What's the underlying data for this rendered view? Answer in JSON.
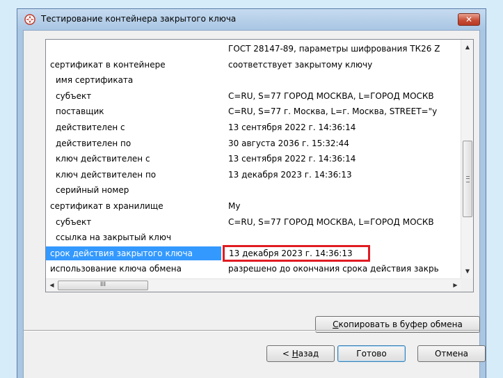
{
  "window": {
    "title": "Тестирование контейнера закрытого ключа",
    "close_label": "✕"
  },
  "grid": {
    "rows": [
      {
        "name": "",
        "value": "ГОСТ 28147-89, параметры шифрования ТК26 Z",
        "indent": false
      },
      {
        "name": "сертификат в контейнере",
        "value": "соответствует закрытому ключу",
        "indent": false
      },
      {
        "name": "имя сертификата",
        "value": "",
        "indent": true
      },
      {
        "name": "субъект",
        "value": "C=RU, S=77 ГОРОД МОСКВА, L=ГОРОД МОСКВ",
        "indent": true
      },
      {
        "name": "поставщик",
        "value": "C=RU, S=77 г. Москва, L=г. Москва, STREET=\"у",
        "indent": true
      },
      {
        "name": "действителен с",
        "value": "13 сентября 2022 г. 14:36:14",
        "indent": true
      },
      {
        "name": "действителен по",
        "value": "30 августа 2036 г. 15:32:44",
        "indent": true
      },
      {
        "name": "ключ действителен с",
        "value": "13 сентября 2022 г. 14:36:14",
        "indent": true
      },
      {
        "name": "ключ действителен по",
        "value": "13 декабря 2023 г. 14:36:13",
        "indent": true
      },
      {
        "name": "серийный номер",
        "value": "",
        "indent": true
      },
      {
        "name": "сертификат в хранилище",
        "value": "My",
        "indent": false
      },
      {
        "name": "субъект",
        "value": "C=RU, S=77 ГОРОД МОСКВА, L=ГОРОД МОСКВ",
        "indent": true
      },
      {
        "name": "ссылка на закрытый ключ",
        "value": "",
        "indent": true
      },
      {
        "name": "срок действия закрытого ключа",
        "value": "13 декабря 2023 г. 14:36:13",
        "indent": false,
        "selected": true,
        "highlighted": true
      },
      {
        "name": "использование ключа обмена",
        "value": "разрешено до окончания срока действия закрь",
        "indent": false
      }
    ],
    "hscroll_thumb_glyph": "III"
  },
  "buttons": {
    "copy": "Скопировать в буфер обмена",
    "back": "< Назад",
    "finish": "Готово",
    "cancel": "Отмена"
  },
  "colors": {
    "selection": "#3399ff",
    "highlight_border": "#e01b22"
  }
}
